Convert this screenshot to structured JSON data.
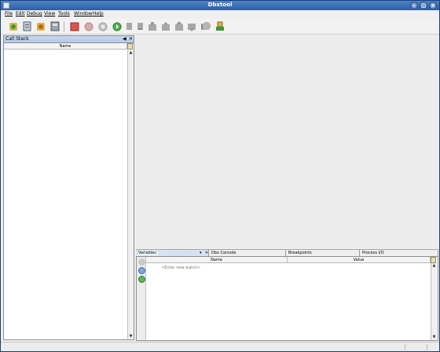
{
  "window": {
    "title": "Dbxtool"
  },
  "menubar": {
    "items": [
      "File",
      "Edit",
      "Debug",
      "View",
      "Tools",
      "Window",
      "Help"
    ]
  },
  "toolbar": {
    "buttons": [
      "run-debug-icon",
      "attach-icon",
      "core-icon",
      "session-icon",
      "stop-icon",
      "pause-icon",
      "restart-icon",
      "continue-icon",
      "step-over-icon",
      "step-into-icon",
      "step-out-icon",
      "run-to-cursor-icon",
      "up-icon",
      "down-icon",
      "pop-icon",
      "breakpoint-icon",
      "terminate-icon"
    ]
  },
  "call_stack": {
    "title": "Call Stack",
    "column": "Name",
    "pin_glyph": "◀",
    "close_glyph": "✕"
  },
  "bottom_tabs": {
    "items": [
      "Variables",
      "Dbx Console",
      "Breakpoints",
      "Process I/O"
    ],
    "active": "Variables",
    "menu_glyph": "▾",
    "close_glyph": "✕"
  },
  "variables": {
    "columns": [
      "Name",
      "Value"
    ],
    "watch_placeholder": "<Enter new watch>"
  },
  "colors": {
    "titlebar": "#3a6db4",
    "header": "#bcd0ec",
    "desktop": "#3d6fb6"
  }
}
